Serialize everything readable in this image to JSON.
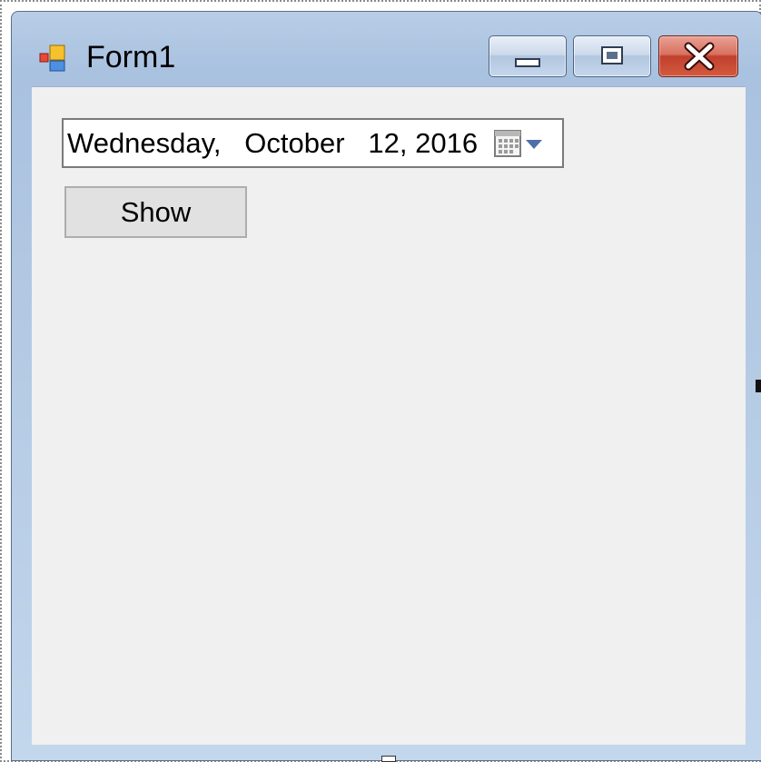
{
  "window": {
    "title": "Form1",
    "icon": "winforms-app-icon",
    "controls": {
      "minimize_icon": "minimize-icon",
      "maximize_icon": "maximize-icon",
      "close_icon": "close-icon"
    }
  },
  "form": {
    "date_picker": {
      "value": "Wednesday,   October   12, 2016",
      "dropdown_icon": "calendar-dropdown-icon"
    },
    "show_button": {
      "label": "Show"
    }
  },
  "colors": {
    "frame": "#b3c9e3",
    "client_background": "#f0f0f0",
    "close_button": "#c0402c",
    "button_face": "#e1e1e1"
  }
}
